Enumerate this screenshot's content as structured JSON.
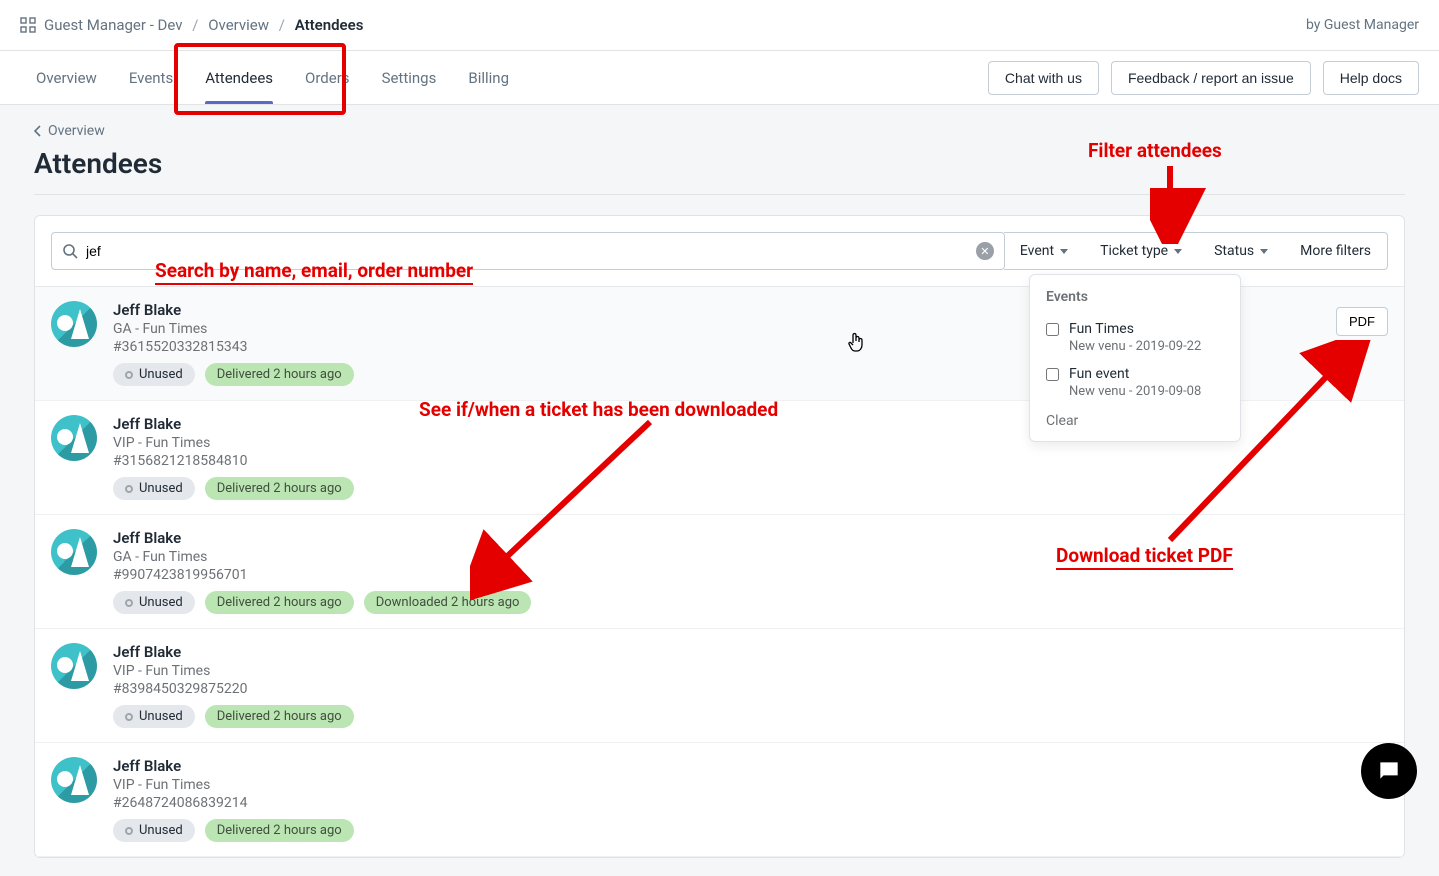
{
  "breadcrumb": {
    "app": "Guest Manager - Dev",
    "section": "Overview",
    "page": "Attendees",
    "byline": "by Guest Manager"
  },
  "nav": {
    "tabs": [
      "Overview",
      "Events",
      "Attendees",
      "Orders",
      "Settings",
      "Billing"
    ],
    "active": "Attendees",
    "actions": {
      "chat": "Chat with us",
      "feedback": "Feedback / report an issue",
      "help": "Help docs"
    }
  },
  "page": {
    "back_label": "Overview",
    "title": "Attendees"
  },
  "search": {
    "value": "jef",
    "placeholder": ""
  },
  "filters": {
    "event": "Event",
    "ticket_type": "Ticket type",
    "status": "Status",
    "more": "More filters"
  },
  "dropdown": {
    "title": "Events",
    "items": [
      {
        "label": "Fun Times",
        "sub": "New venu - 2019-09-22"
      },
      {
        "label": "Fun event",
        "sub": "New venu - 2019-09-08"
      }
    ],
    "clear": "Clear"
  },
  "attendees": [
    {
      "name": "Jeff Blake",
      "ticket": "GA - Fun Times",
      "order": "#3615520332815343",
      "unused": "Unused",
      "delivered": "Delivered 2 hours ago",
      "downloaded": null,
      "pdf": "PDF",
      "hover": true
    },
    {
      "name": "Jeff Blake",
      "ticket": "VIP - Fun Times",
      "order": "#3156821218584810",
      "unused": "Unused",
      "delivered": "Delivered 2 hours ago",
      "downloaded": null,
      "pdf": null
    },
    {
      "name": "Jeff Blake",
      "ticket": "GA - Fun Times",
      "order": "#9907423819956701",
      "unused": "Unused",
      "delivered": "Delivered 2 hours ago",
      "downloaded": "Downloaded 2 hours ago",
      "pdf": null
    },
    {
      "name": "Jeff Blake",
      "ticket": "VIP - Fun Times",
      "order": "#8398450329875220",
      "unused": "Unused",
      "delivered": "Delivered 2 hours ago",
      "downloaded": null,
      "pdf": null
    },
    {
      "name": "Jeff Blake",
      "ticket": "VIP - Fun Times",
      "order": "#2648724086839214",
      "unused": "Unused",
      "delivered": "Delivered 2 hours ago",
      "downloaded": null,
      "pdf": null
    }
  ],
  "annotations": {
    "search_hint": "Search by name, email, order number",
    "filter_hint": "Filter attendees",
    "download_hint": "See if/when a ticket has been downloaded",
    "pdf_hint": "Download ticket PDF"
  }
}
